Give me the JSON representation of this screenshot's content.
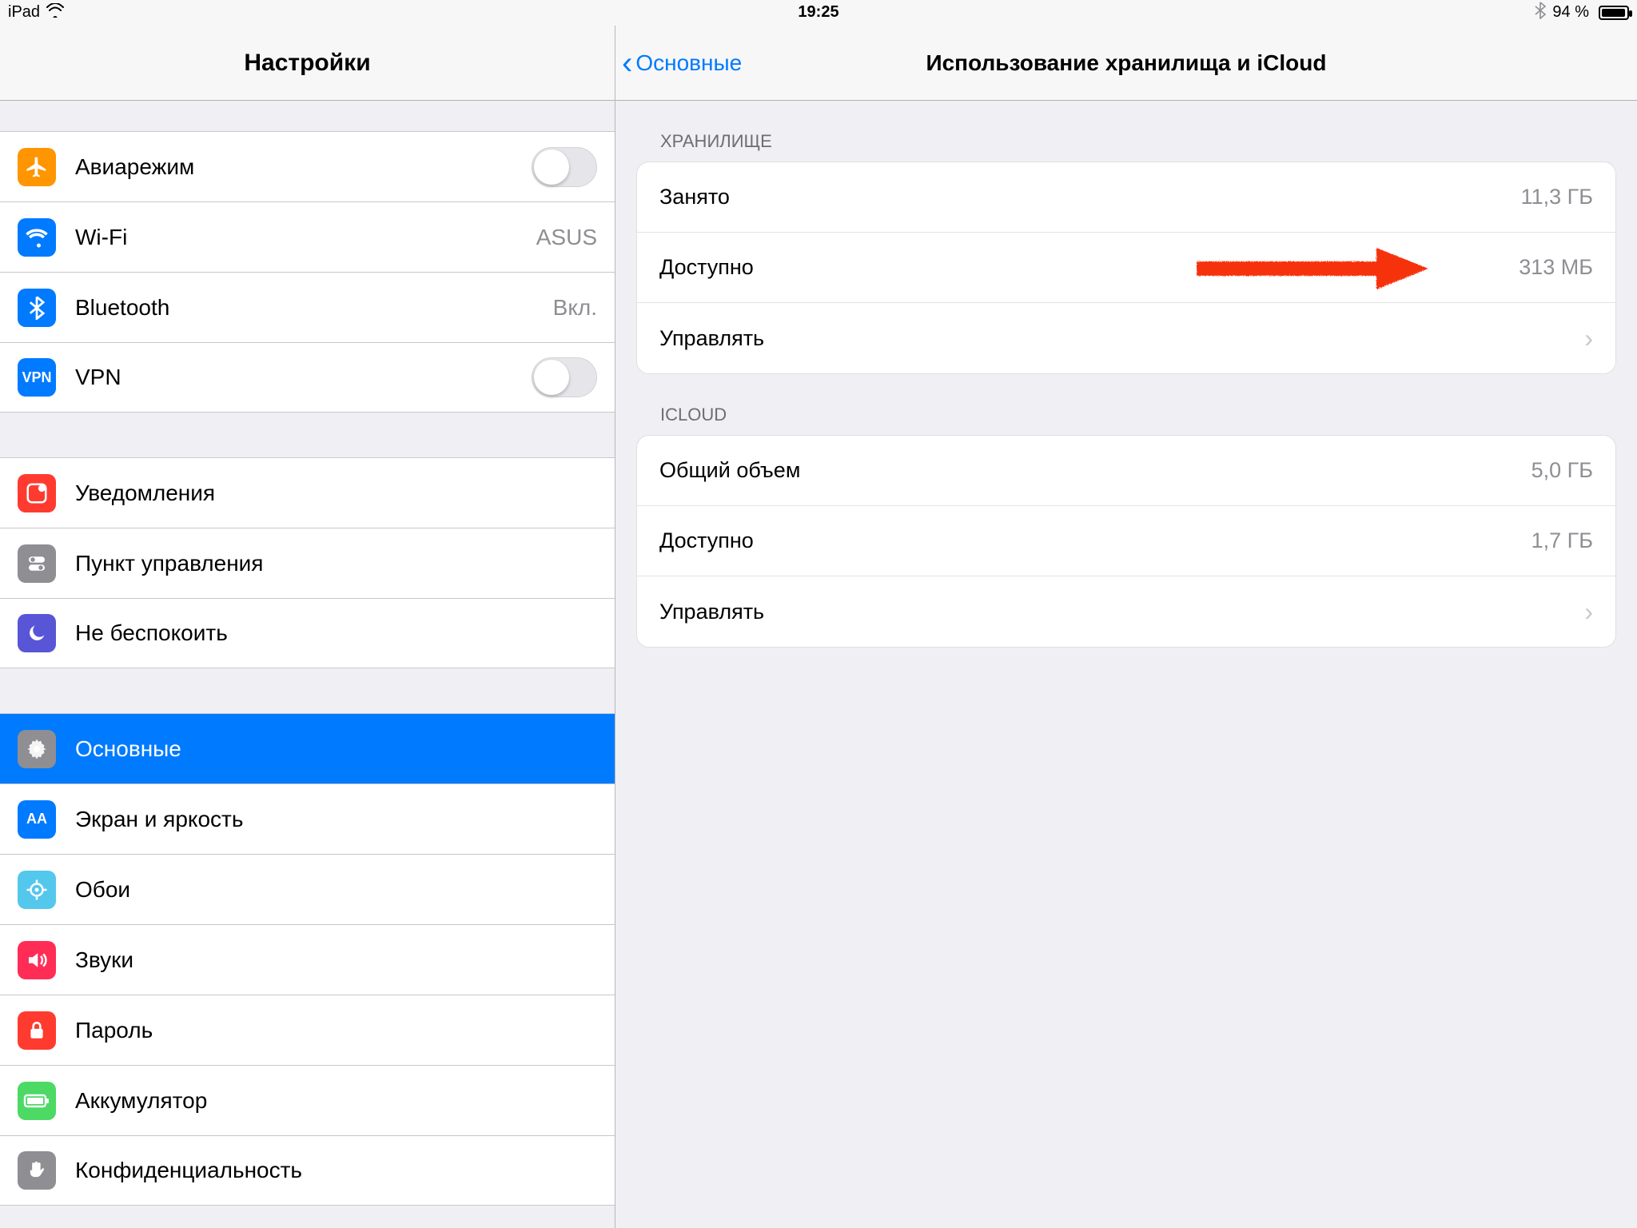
{
  "status": {
    "device": "iPad",
    "time": "19:25",
    "battery_text": "94 %"
  },
  "sidebar": {
    "title": "Настройки",
    "groups": [
      {
        "rows": [
          {
            "icon": "airplane",
            "label": "Авиарежим",
            "control": "toggle"
          },
          {
            "icon": "wifi",
            "label": "Wi-Fi",
            "value": "ASUS"
          },
          {
            "icon": "bluetooth",
            "label": "Bluetooth",
            "value": "Вкл."
          },
          {
            "icon": "vpn",
            "label": "VPN",
            "control": "toggle"
          }
        ]
      },
      {
        "rows": [
          {
            "icon": "notifications",
            "label": "Уведомления"
          },
          {
            "icon": "controlcenter",
            "label": "Пункт управления"
          },
          {
            "icon": "dnd",
            "label": "Не беспокоить"
          }
        ]
      },
      {
        "rows": [
          {
            "icon": "general",
            "label": "Основные",
            "selected": true
          },
          {
            "icon": "display",
            "label": "Экран и яркость"
          },
          {
            "icon": "wallpaper",
            "label": "Обои"
          },
          {
            "icon": "sounds",
            "label": "Звуки"
          },
          {
            "icon": "passcode",
            "label": "Пароль"
          },
          {
            "icon": "battery",
            "label": "Аккумулятор"
          },
          {
            "icon": "privacy",
            "label": "Конфиденциальность"
          }
        ]
      }
    ]
  },
  "content": {
    "back_label": "Основные",
    "title": "Использование хранилища и iCloud",
    "sections": [
      {
        "header": "ХРАНИЛИЩЕ",
        "rows": [
          {
            "label": "Занято",
            "value": "11,3 ГБ"
          },
          {
            "label": "Доступно",
            "value": "313 МБ",
            "annotated": true
          },
          {
            "label": "Управлять",
            "chevron": true
          }
        ]
      },
      {
        "header": "ICLOUD",
        "rows": [
          {
            "label": "Общий объем",
            "value": "5,0 ГБ"
          },
          {
            "label": "Доступно",
            "value": "1,7 ГБ"
          },
          {
            "label": "Управлять",
            "chevron": true
          }
        ]
      }
    ]
  }
}
